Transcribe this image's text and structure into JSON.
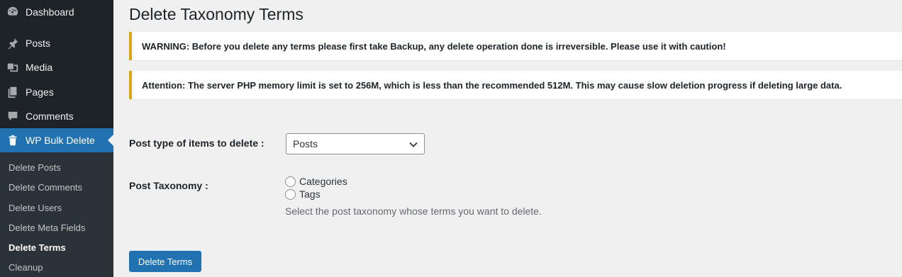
{
  "sidebar": {
    "menu": [
      {
        "label": "Dashboard",
        "icon": "dashboard-icon"
      },
      {
        "label": "Posts",
        "icon": "pin-icon"
      },
      {
        "label": "Media",
        "icon": "media-icon"
      },
      {
        "label": "Pages",
        "icon": "pages-icon"
      },
      {
        "label": "Comments",
        "icon": "comment-icon"
      },
      {
        "label": "WP Bulk Delete",
        "icon": "trash-icon"
      }
    ],
    "submenu": [
      {
        "label": "Delete Posts"
      },
      {
        "label": "Delete Comments"
      },
      {
        "label": "Delete Users"
      },
      {
        "label": "Delete Meta Fields"
      },
      {
        "label": "Delete Terms"
      },
      {
        "label": "Cleanup"
      }
    ]
  },
  "main": {
    "title": "Delete Taxonomy Terms",
    "notices": [
      "WARNING: Before you delete any terms please first take Backup, any delete operation done is irreversible. Please use it with caution!",
      "Attention: The server PHP memory limit is set to 256M, which is less than the recommended 512M. This may cause slow deletion progress if deleting large data."
    ],
    "post_type_label": "Post type of items to delete :",
    "post_type_value": "Posts",
    "taxonomy_label": "Post Taxonomy :",
    "taxonomy_options": [
      {
        "label": "Categories",
        "selected": false
      },
      {
        "label": "Tags",
        "selected": false
      }
    ],
    "taxonomy_help": "Select the post taxonomy whose terms you want to delete.",
    "delete_button": "Delete Terms"
  },
  "colors": {
    "sidebar_bg": "#1d2327",
    "submenu_bg": "#2c3338",
    "accent": "#2271b1",
    "warning_border": "#dba617"
  }
}
